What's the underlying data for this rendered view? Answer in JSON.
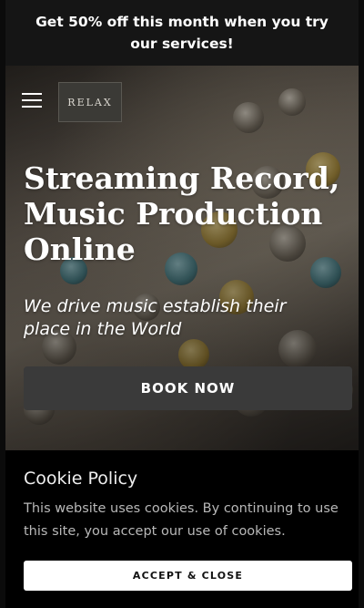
{
  "promo": {
    "text": "Get 50% off this month when you try our services!"
  },
  "header": {
    "logo_text": "RELAX"
  },
  "hero": {
    "title": "Streaming Record, Music Production Online",
    "subtitle": "We drive music establish their place in the World",
    "cta_label": "BOOK NOW"
  },
  "cookie": {
    "title": "Cookie Policy",
    "message": "This website uses cookies. By continuing to use this site, you accept our use of cookies.",
    "accept_label": "ACCEPT & CLOSE"
  },
  "colors": {
    "promo_bg": "#151515",
    "cta_bg": "#3a3a3a",
    "cookie_bg": "#000000",
    "accept_bg": "#ffffff"
  },
  "icons": {
    "menu": "hamburger-menu-icon"
  }
}
